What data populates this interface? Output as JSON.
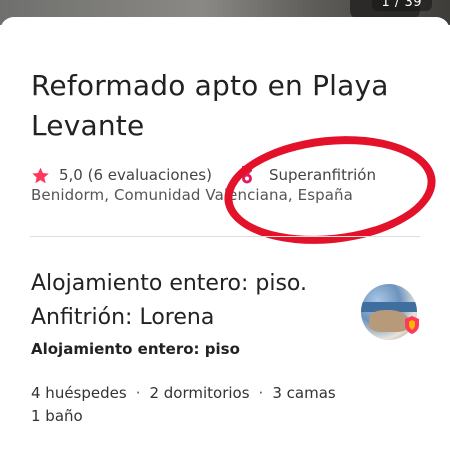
{
  "photo": {
    "counter": "1 / 39"
  },
  "listing": {
    "title": "Reformado apto en Playa Levante",
    "rating": "5,0",
    "reviews": "(6 evaluaciones)",
    "host_badge": "Superanfitrión",
    "location": "Benidorm, Comunidad Valenciana, España",
    "type_title": "Alojamiento entero: piso. Anfitrión: Lorena",
    "type_sub": "Alojamiento entero: piso",
    "amenities": [
      "4 huéspedes",
      "2 dormitorios",
      "3 camas",
      "1 baño"
    ],
    "separator": "·"
  },
  "icons": {
    "star": "star-icon",
    "medal": "superhost-medal-icon",
    "avatar_badge": "superhost-shield-icon"
  },
  "colors": {
    "brand": "#ff385c",
    "highlight": "#e3122a",
    "text": "#222222"
  }
}
